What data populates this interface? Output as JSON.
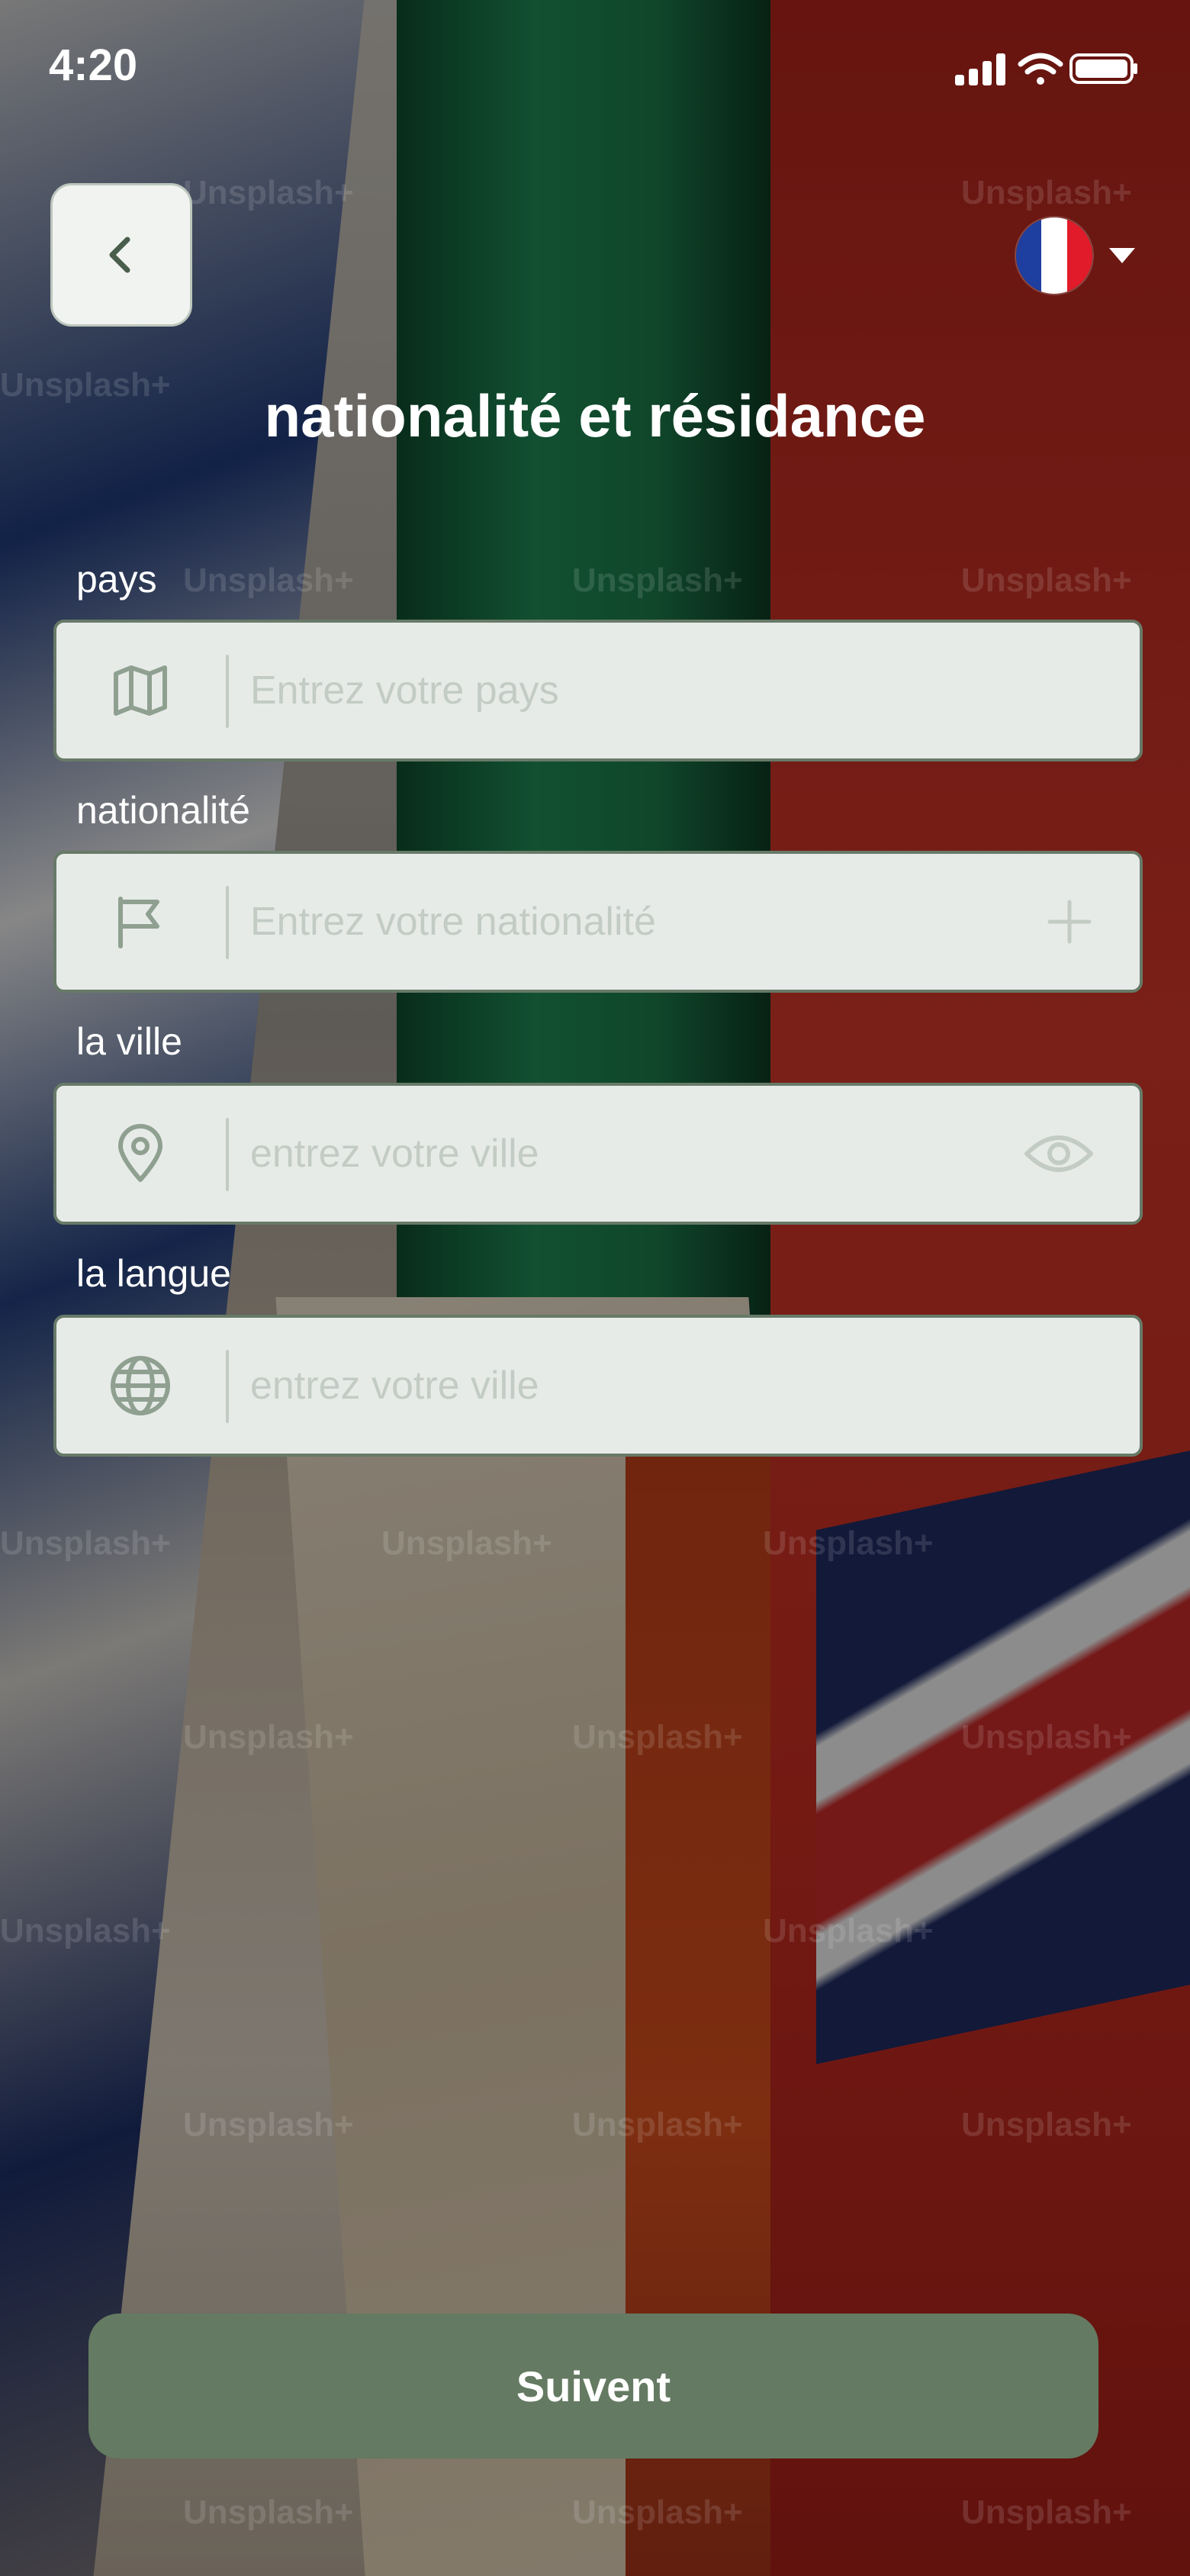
{
  "status_bar": {
    "time": "4:20",
    "icons": [
      "signal-icon",
      "wifi-icon",
      "battery-icon"
    ]
  },
  "header": {
    "back_icon": "chevron-left-icon",
    "language_flag": "france-flag",
    "language_caret_icon": "caret-down-icon",
    "title": "nationalité et résidance"
  },
  "form": {
    "fields": [
      {
        "label": "pays",
        "placeholder": "Entrez votre pays",
        "icon": "map-icon"
      },
      {
        "label": "nationalité",
        "placeholder": "Entrez votre nationalité",
        "icon": "flag-icon",
        "trailing_icon": "plus-icon"
      },
      {
        "label": "la ville",
        "placeholder": "entrez votre ville",
        "icon": "location-pin-icon",
        "trailing_icon": "eye-icon"
      },
      {
        "label": "la langue",
        "placeholder": "entrez votre ville",
        "icon": "globe-icon"
      }
    ]
  },
  "footer": {
    "submit_label": "Suivent"
  },
  "background": {
    "watermark_text": "Unsplash+"
  },
  "colors": {
    "accent": "#647a62",
    "field_background": "#e7ebe8",
    "field_border": "#677a68",
    "icon_color": "#8fa091"
  }
}
